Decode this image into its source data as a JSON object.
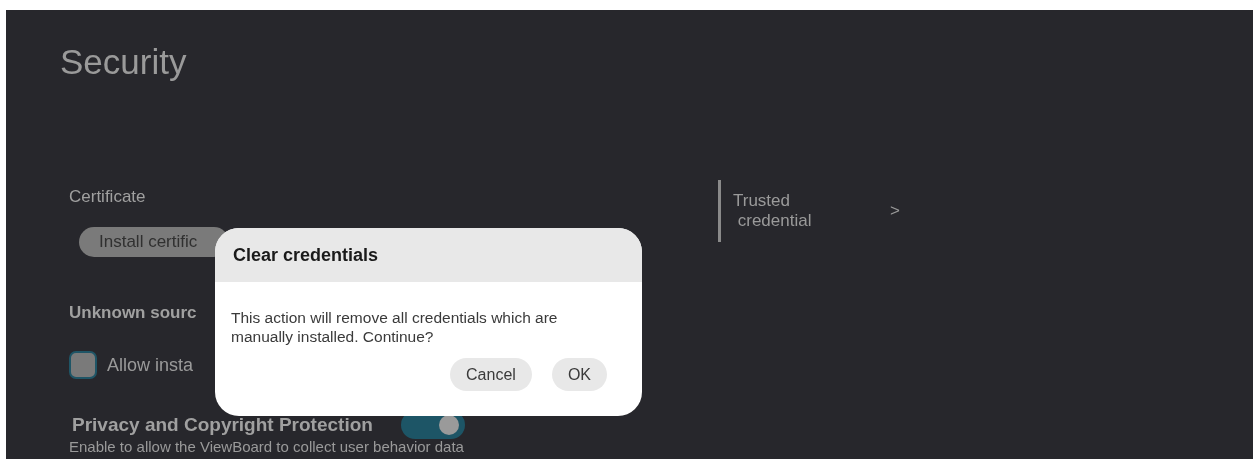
{
  "page": {
    "title": "Security"
  },
  "certificate": {
    "label": "Certificate",
    "install_button": "Install certific"
  },
  "unknown_sources": {
    "heading": "Unknown sourc",
    "checkbox": {
      "label": "Allow insta",
      "checked": false
    }
  },
  "privacy": {
    "heading": "Privacy and Copyright Protection",
    "toggle": {
      "on": true
    },
    "description": "Enable to allow the ViewBoard to collect user behavior data"
  },
  "side_menu": {
    "items": [
      {
        "label": "Trusted\n credential",
        "selected": true,
        "arrow": ">"
      }
    ]
  },
  "dialog": {
    "title": "Clear credentials",
    "message": "This action will remove all credentials which are manually installed. Continue?",
    "buttons": [
      "Cancel",
      "OK"
    ]
  }
}
